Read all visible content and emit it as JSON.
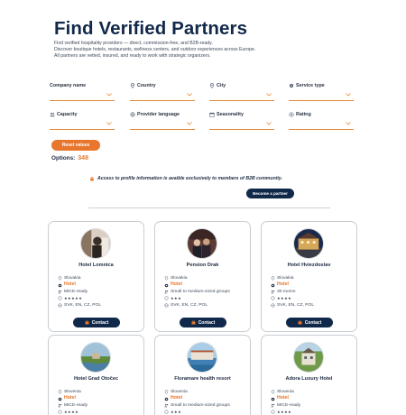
{
  "hero": {
    "title": "Find Verified Partners",
    "lines": [
      "Find verified hospitality providers — direct, commission-free, and B2B-ready.",
      "Discover boutique hotels, restaurants, wellness centers, and outdoor experiences across Europe.",
      "All partners are vetted, insured, and ready to work with strategic organizers."
    ]
  },
  "filters": [
    {
      "label": "Company name",
      "icon": "none"
    },
    {
      "label": "Country",
      "icon": "pin-icon"
    },
    {
      "label": "City",
      "icon": "pin-icon"
    },
    {
      "label": "Service type",
      "icon": "gear-icon"
    },
    {
      "label": "Capacity",
      "icon": "people-icon"
    },
    {
      "label": "Provider language",
      "icon": "globe-icon"
    },
    {
      "label": "Seasonality",
      "icon": "calendar-icon"
    },
    {
      "label": "Rating",
      "icon": "star-badge-icon"
    }
  ],
  "reset_label": "Reset values",
  "options": {
    "label": "Options:",
    "count": "348"
  },
  "access_note": "Access to profile information is avaible exclusively to members of B2B community.",
  "become_partner": "Become a partner",
  "contact_label": "Contact",
  "colors": {
    "accent": "#e8762c",
    "navy": "#10294a"
  },
  "cards": [
    {
      "name": "Hotel Lomnica",
      "country": "Slovakia",
      "type": "Hotel",
      "capacity": "MICE-ready",
      "stars": "★★★★★",
      "languages": "SVK, EN, CZ, POL"
    },
    {
      "name": "Pension Drak",
      "country": "Slovakia",
      "type": "Hotel",
      "capacity": "Small to medium-sized groups",
      "stars": "★★★",
      "languages": "SVK, EN, CZ, POL"
    },
    {
      "name": "Hotel Hviezdoslav",
      "country": "Slovakia",
      "type": "Hotel",
      "capacity": "30 rooms",
      "stars": "★★★★",
      "languages": "SVK, EN, CZ, POL"
    },
    {
      "name": "Hotel Grad Otočec",
      "country": "Slovenia",
      "type": "Hotel",
      "capacity": "MICE-ready",
      "stars": "★★★★",
      "languages": ""
    },
    {
      "name": "Floramare health resort",
      "country": "Slovenia",
      "type": "Hotel",
      "capacity": "Small to medium-sized groups",
      "stars": "★★★",
      "languages": ""
    },
    {
      "name": "Adora Luxury Hotel",
      "country": "Slovenia",
      "type": "Hotel",
      "capacity": "MICE-ready",
      "stars": "★★★★",
      "languages": ""
    }
  ]
}
